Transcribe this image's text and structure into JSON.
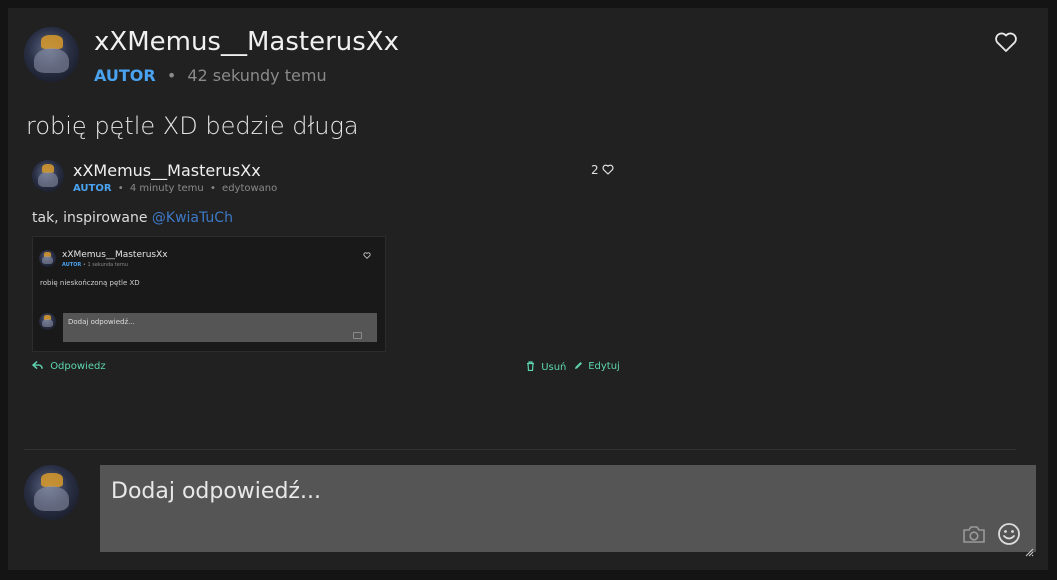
{
  "post": {
    "username": "xXMemus__MasterusXx",
    "badge": "AUTOR",
    "separator": "•",
    "time": "42 sekundy temu",
    "text": "robię pętle XD bedzie długa"
  },
  "embedded": {
    "username": "xXMemus__MasterusXx",
    "badge": "AUTOR",
    "separator": "•",
    "time": "4 minuty temu",
    "separator2": "•",
    "edited": "edytowano",
    "likes": "2",
    "text": "tak, inspirowane",
    "mention": "@KwiaTuCh",
    "screenshot": {
      "username": "xXMemus__MasterusXx",
      "badge": "AUTOR",
      "separator": "•",
      "time": "1 sekunda temu",
      "text": "robię nieskończoną pętle XD",
      "reply_placeholder": "Dodaj odpowiedź..."
    },
    "actions": {
      "reply": "Odpowiedz",
      "delete": "Usuń",
      "edit": "Edytuj"
    }
  },
  "composer": {
    "placeholder": "Dodaj odpowiedź..."
  },
  "icons": {
    "like": "heart-icon",
    "reply": "reply-arrow-icon",
    "delete": "trash-icon",
    "edit": "pencil-icon",
    "camera": "camera-icon",
    "emoji": "smiley-icon"
  },
  "colors": {
    "badge": "#4aa3f0",
    "accent": "#5dd6b0",
    "mention": "#3d79c7",
    "composer_bg": "#555555"
  }
}
